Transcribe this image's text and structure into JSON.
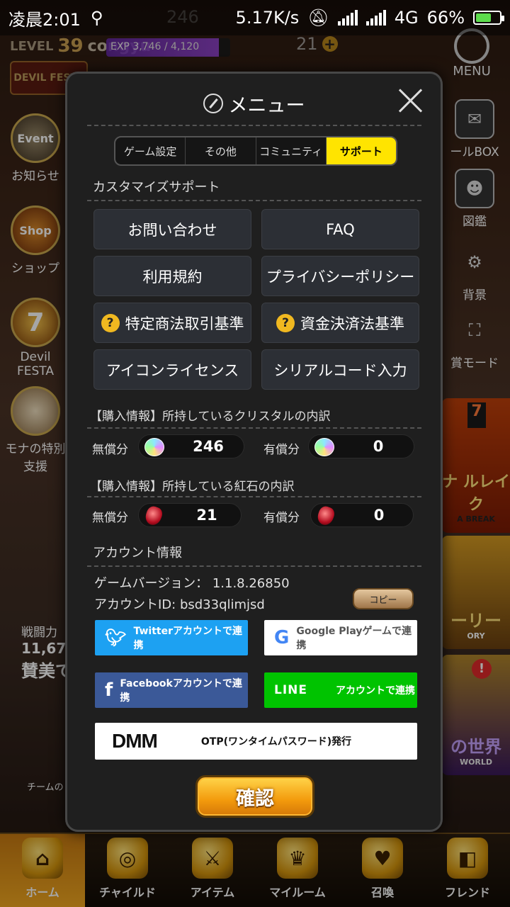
{
  "status_bar": {
    "time": "凌晨2:01",
    "net_speed": "5.17K/s",
    "network": "4G",
    "battery": "66%",
    "battery_level": 0.66
  },
  "hud": {
    "level_prefix": "LEVEL",
    "level": "39",
    "player": "congyu",
    "exp": "EXP 3,746 / 4,120",
    "exp_fraction": 0.91,
    "crystal_top": "246",
    "red_top": "21",
    "menu_label": "MENU",
    "festa": "DEVIL FESTA"
  },
  "left_side": [
    {
      "icon": "Event",
      "label": "お知らせ"
    },
    {
      "icon": "Shop",
      "label": "ショップ"
    },
    {
      "icon": "7",
      "label": "Devil FESTA"
    },
    {
      "icon": "",
      "label": "モナの特別支援"
    }
  ],
  "left_stats": {
    "power_label": "戦闘力",
    "power_value": "11,670",
    "praise": "賛美で",
    "team_label": "チームの"
  },
  "right_side": [
    {
      "label": "ールBOX"
    },
    {
      "label": "図鑑"
    },
    {
      "label": "背景"
    },
    {
      "label": "賞モード"
    }
  ],
  "right_banners": {
    "season": "7",
    "b1": "ナ ルレイク",
    "b1_sub": "A BREAK",
    "b2": "ーリー",
    "b2_sub": "ORY",
    "b3": "の世界",
    "b3_sub": "WORLD"
  },
  "bottom_nav": [
    {
      "label": "ホーム",
      "active": true
    },
    {
      "label": "チャイルド",
      "active": false
    },
    {
      "label": "アイテム",
      "active": false
    },
    {
      "label": "マイルーム",
      "active": false
    },
    {
      "label": "召喚",
      "active": false
    },
    {
      "label": "フレンド",
      "active": false
    }
  ],
  "dialog": {
    "title": "メニュー",
    "tabs": [
      {
        "label": "ゲーム設定",
        "active": false
      },
      {
        "label": "その他",
        "active": false
      },
      {
        "label": "コミュニティ",
        "active": false
      },
      {
        "label": "サポート",
        "active": true
      }
    ],
    "custom_support_heading": "カスタマイズサポート",
    "buttons": {
      "contact": "お問い合わせ",
      "faq": "FAQ",
      "terms": "利用規約",
      "privacy": "プライバシーポリシー",
      "commerce": "特定商法取引基準",
      "payment": "資金決済法基準",
      "icon_license": "アイコンライセンス",
      "serial_code": "シリアルコード入力"
    },
    "crystal_heading": "【購入情報】所持しているクリスタルの内訳",
    "red_heading": "【購入情報】所持している紅石の内訳",
    "free_label": "無償分",
    "paid_label": "有償分",
    "crystal_free": "246",
    "crystal_paid": "0",
    "red_free": "21",
    "red_paid": "0",
    "account_heading": "アカウント情報",
    "game_version": "ゲームバージョン： 1.1.8.26850",
    "account_id": "アカウントID: bsd33qlimjsd",
    "copy": "コピー",
    "twitter": "Twitterアカウントで連携",
    "google": "Google Playゲームで連携",
    "facebook": "Facebookアカウントで連携",
    "line_logo": "LINE",
    "line": "アカウントで連携",
    "dmm_logo": "DMM",
    "dmm": "OTP(ワンタイムパスワード)発行",
    "confirm": "確認"
  },
  "colors": {
    "tab_active": "#ffe400",
    "twitter": "#1da1f2",
    "facebook": "#3b5998",
    "line": "#00c300",
    "confirm": "#f39a0c"
  }
}
